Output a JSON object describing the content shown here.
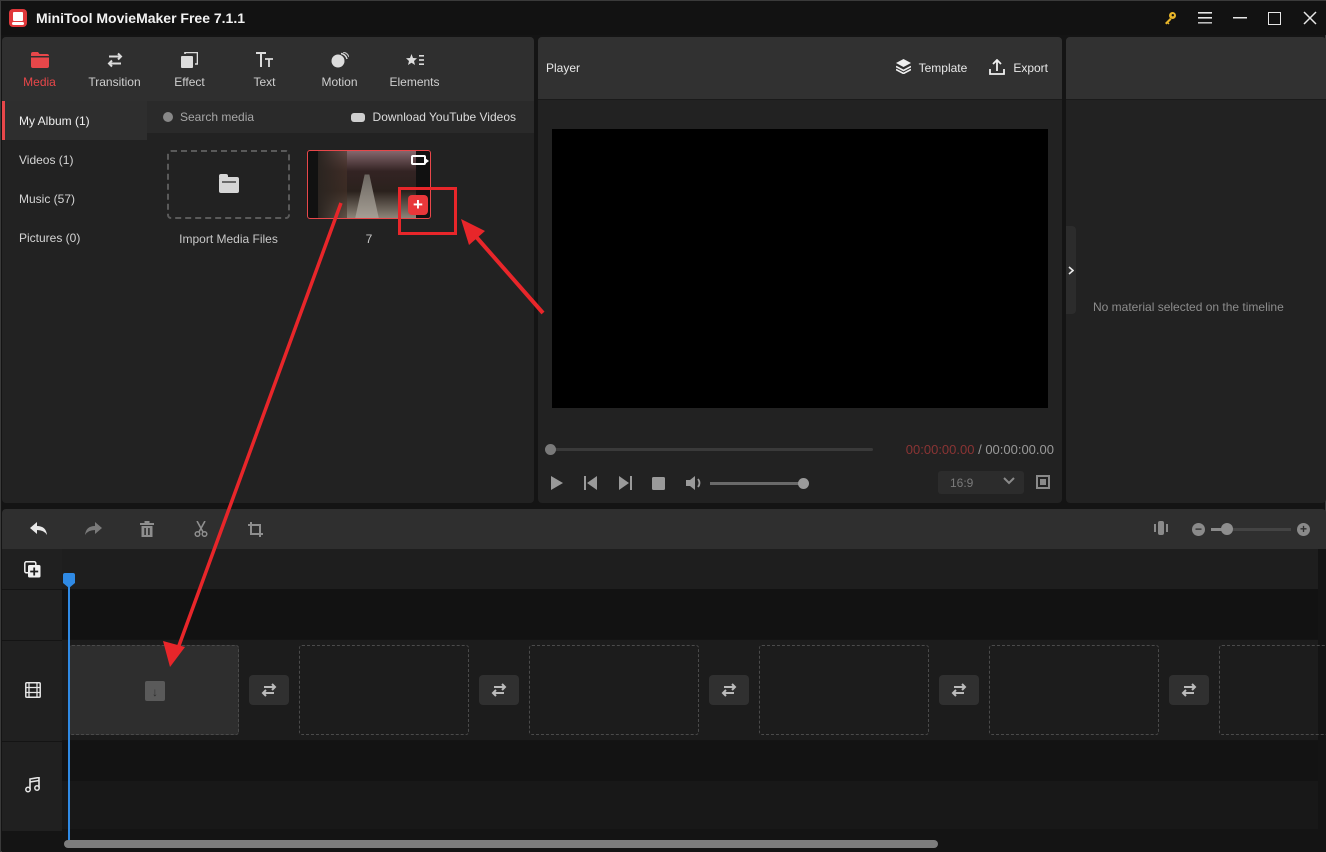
{
  "app": {
    "title": "MiniTool MovieMaker Free 7.1.1",
    "window_controls": [
      "key-icon",
      "menu-icon",
      "minimize-icon",
      "maximize-icon",
      "close-icon"
    ]
  },
  "tabs": [
    {
      "label": "Media",
      "icon": "folder-icon",
      "active": true
    },
    {
      "label": "Transition",
      "icon": "swap-arrows-icon",
      "active": false
    },
    {
      "label": "Effect",
      "icon": "stacked-squares-icon",
      "active": false
    },
    {
      "label": "Text",
      "icon": "text-tt-icon",
      "active": false
    },
    {
      "label": "Motion",
      "icon": "motion-ball-icon",
      "active": false
    },
    {
      "label": "Elements",
      "icon": "star-list-icon",
      "active": false
    }
  ],
  "sidebar": {
    "items": [
      {
        "label": "My Album (1)",
        "active": true
      },
      {
        "label": "Videos (1)",
        "active": false
      },
      {
        "label": "Music (57)",
        "active": false
      },
      {
        "label": "Pictures (0)",
        "active": false
      }
    ]
  },
  "media": {
    "search_placeholder": "Search media",
    "download_label": "Download YouTube Videos",
    "import_label": "Import Media Files",
    "items": [
      {
        "name": "7",
        "type": "video"
      }
    ],
    "add_button": "+"
  },
  "player": {
    "title": "Player",
    "template_label": "Template",
    "export_label": "Export",
    "current_time": "00:00:00.00",
    "separator": " / ",
    "total_time": "00:00:00.00",
    "progress": 0,
    "volume": 1.0,
    "aspect_ratio": "16:9"
  },
  "properties": {
    "empty_message": "No material selected on the timeline"
  },
  "timeline": {
    "tools": [
      "undo-icon",
      "redo-icon",
      "delete-icon",
      "split-icon",
      "crop-icon"
    ],
    "zoom_level": 0.15,
    "slot_count": 6
  },
  "colors": {
    "accent": "#e8474a",
    "playhead": "#2f8ae5",
    "annotation": "#e8262a"
  }
}
